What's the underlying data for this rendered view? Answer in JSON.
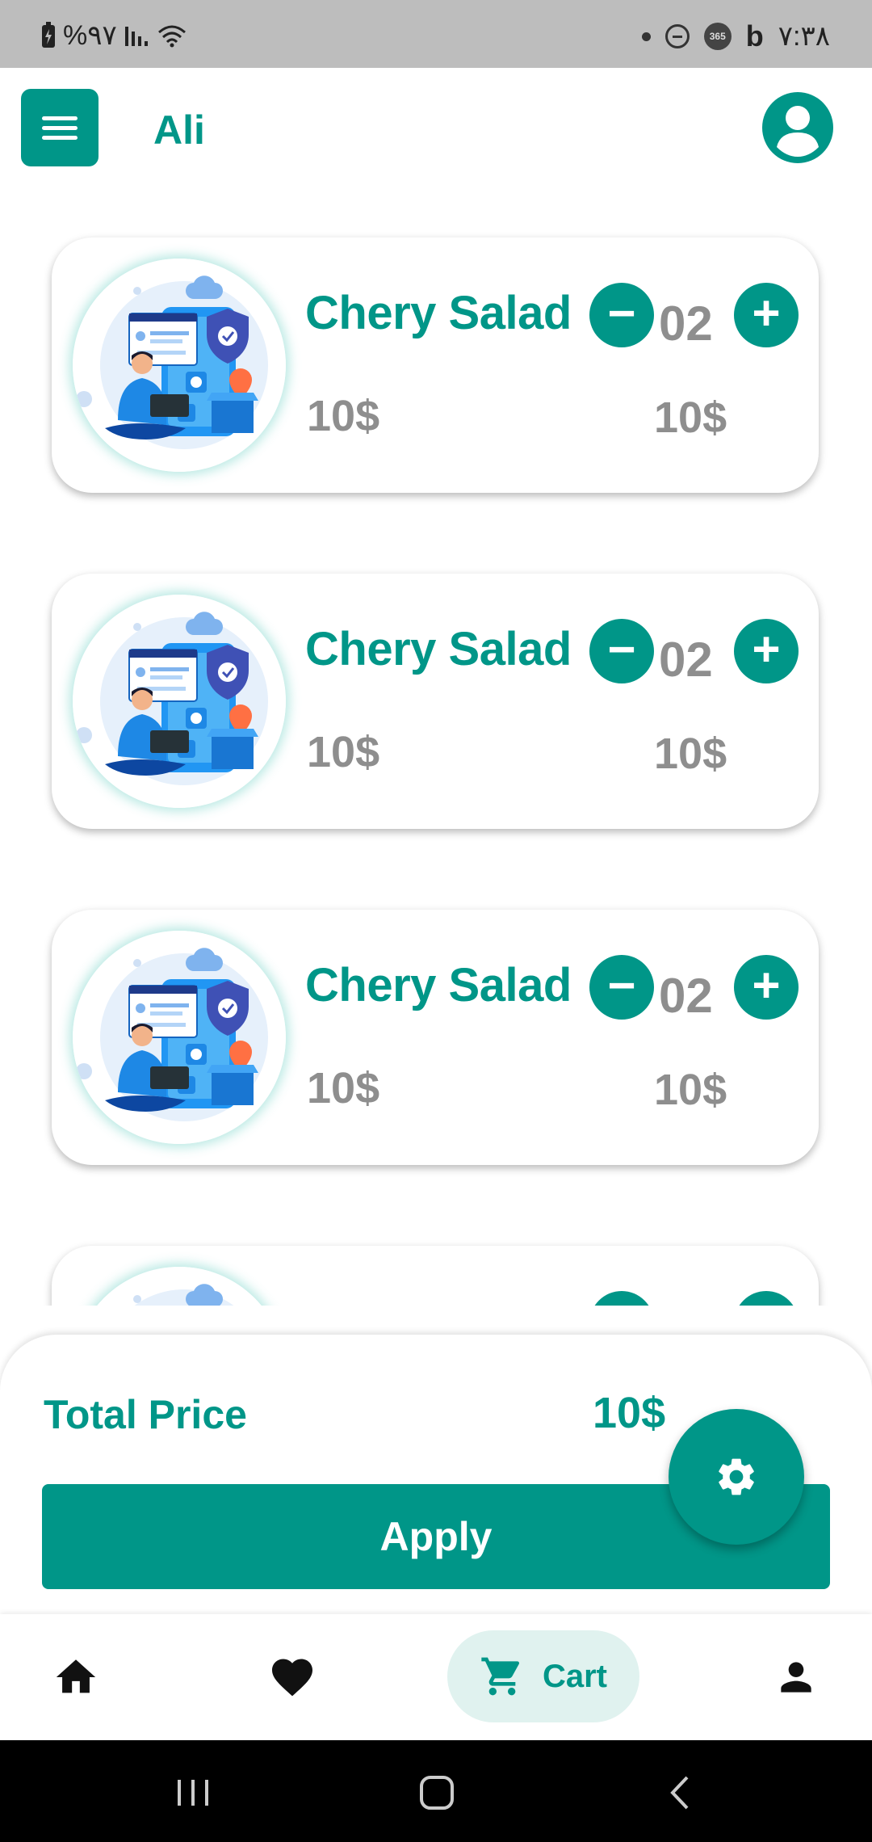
{
  "status_bar": {
    "battery": "%۹۷",
    "time": "۷:۳۸",
    "badge": "365",
    "b_glyph": "b"
  },
  "header": {
    "menu_icon": "hamburger-icon",
    "username": "Ali",
    "avatar_icon": "account-circle-icon"
  },
  "cart_items": [
    {
      "title": "Chery Salad",
      "quantity": "02",
      "price": "10$",
      "total": "10$"
    },
    {
      "title": "Chery Salad",
      "quantity": "02",
      "price": "10$",
      "total": "10$"
    },
    {
      "title": "Chery Salad",
      "quantity": "02",
      "price": "10$",
      "total": "10$"
    }
  ],
  "qty_controls": {
    "minus": "−",
    "plus": "+"
  },
  "summary": {
    "total_label": "Total Price",
    "total_value": "10$",
    "apply_label": "Apply"
  },
  "fab": {
    "icon": "gear-icon"
  },
  "bottom_nav": {
    "items": [
      {
        "icon": "home-icon",
        "active": false
      },
      {
        "icon": "heart-icon",
        "active": false
      },
      {
        "icon": "cart-icon",
        "label": "Cart",
        "active": true
      },
      {
        "icon": "person-icon",
        "active": false
      }
    ]
  },
  "colors": {
    "primary": "#009688",
    "primary_light": "#e0f2ef",
    "muted_text": "#8e8e8e",
    "status_bar": "#bdbdbd"
  }
}
